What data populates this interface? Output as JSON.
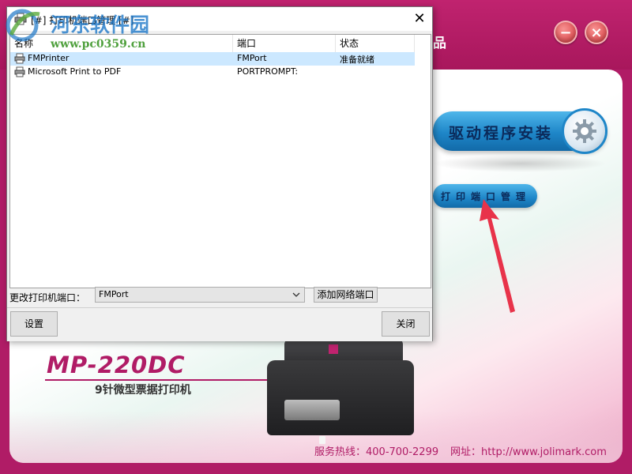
{
  "app": {
    "header_title": "品",
    "min_label": "−",
    "close_label": "×",
    "install_label": "驱动程序安装",
    "port_manage_label": "打印端口管理",
    "model_name": "MP-220DC",
    "model_subtitle": "9针微型票据打印机",
    "hotline_key": "服务热线：",
    "hotline_value": "400-700-2299",
    "website_key": "网址：",
    "website_value": "http://www.jolimark.com"
  },
  "dialog": {
    "title": "[#] 打印机端口管理 [#]",
    "close_label": "✕",
    "columns": [
      "名称",
      "端口",
      "状态"
    ],
    "rows": [
      {
        "name": "FMPrinter",
        "port": "FMPort",
        "status": "准备就绪",
        "selected": true
      },
      {
        "name": "Microsoft Print to PDF",
        "port": "PORTPROMPT:",
        "status": "",
        "selected": false
      }
    ],
    "change_port_label": "更改打印机端口：",
    "port_combo_value": "FMPort",
    "add_network_port_label": "添加网络端口",
    "setup_label": "设置",
    "close_button_label": "关闭"
  },
  "watermark": {
    "title": "河东软件园",
    "url": "www.pc0359.cn"
  },
  "colors": {
    "brand": "#b01c66",
    "button_blue": "#1e86c8",
    "selection": "#cce8ff",
    "arrow": "#e8334a"
  }
}
